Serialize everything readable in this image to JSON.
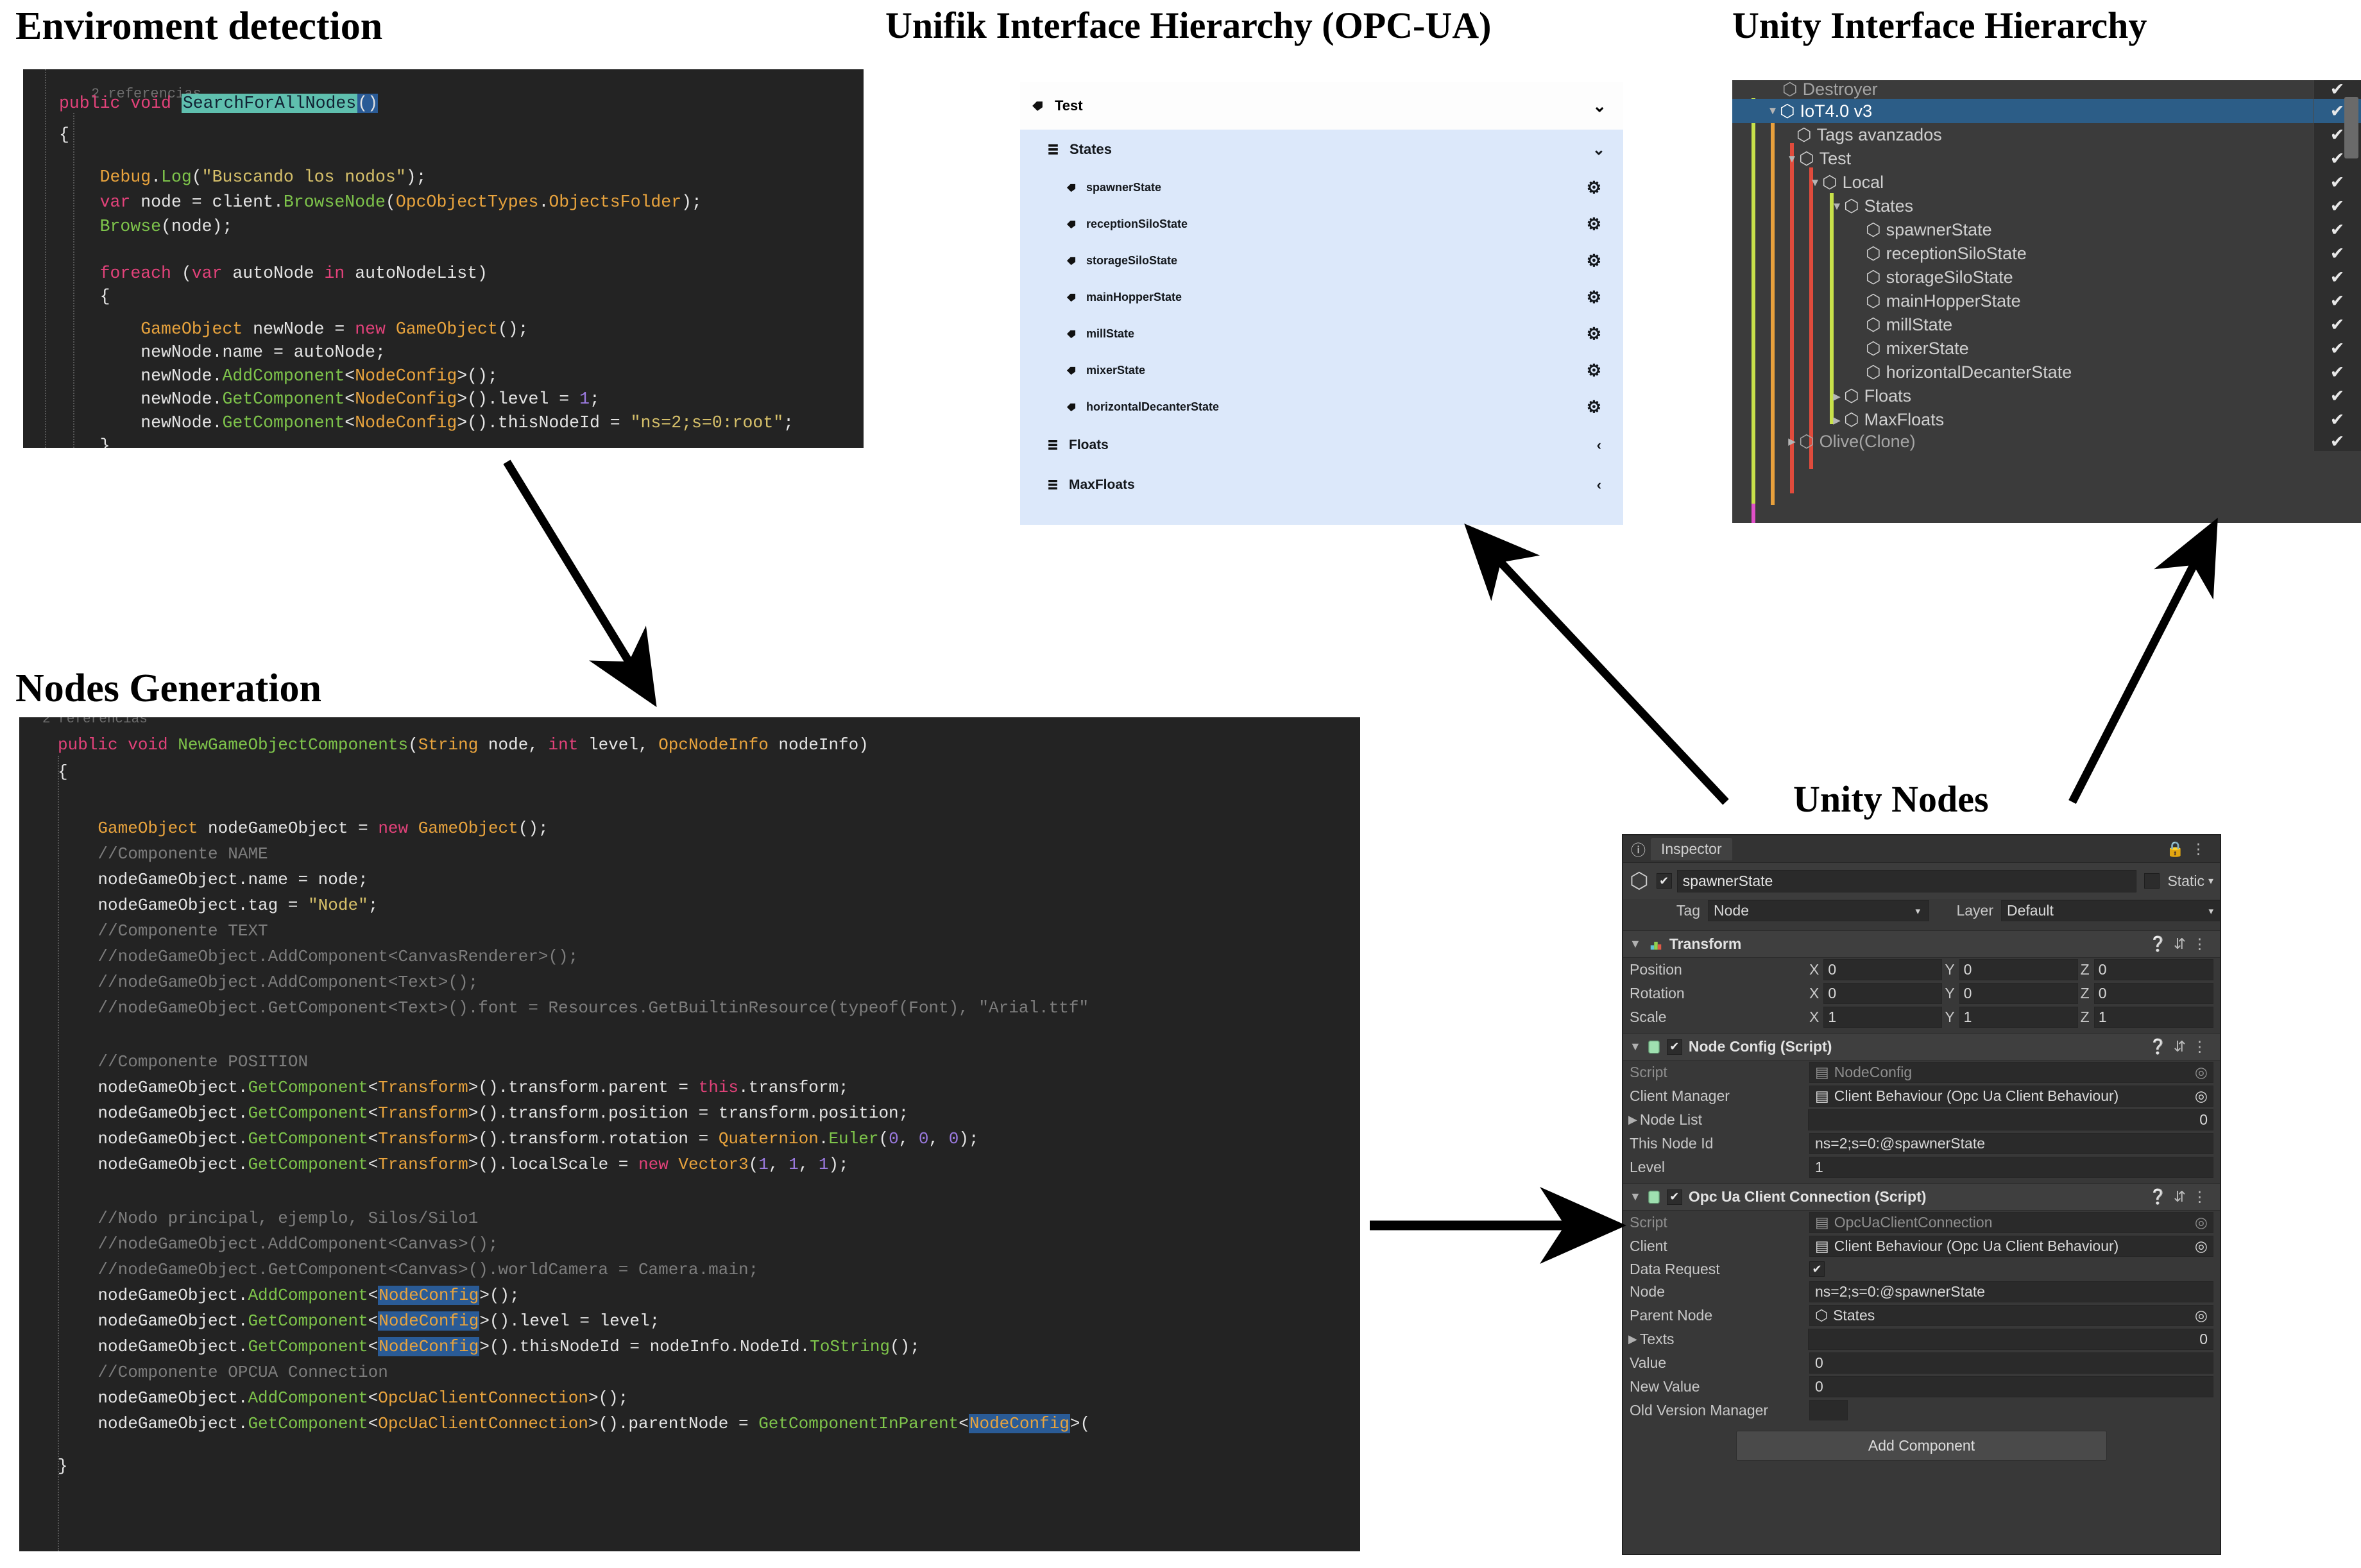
{
  "titles": {
    "environment_detection": "Enviroment detection",
    "unifik_hierarchy": "Unifik Interface Hierarchy (OPC-UA)",
    "unity_hierarchy": "Unity Interface Hierarchy",
    "nodes_generation": "Nodes Generation",
    "unity_nodes": "Unity Nodes"
  },
  "code_environment": {
    "reference_hint": "2 referencias",
    "lines": [
      "public void SearchForAllNodes()",
      "{",
      "    Debug.Log(\"Buscando los nodos\");",
      "    var node = client.BrowseNode(OpcObjectTypes.ObjectsFolder);",
      "    Browse(node);",
      "",
      "    foreach (var autoNode in autoNodeList)",
      "    {",
      "        GameObject newNode = new GameObject();",
      "        newNode.name = autoNode;",
      "        newNode.AddComponent<NodeConfig>();",
      "        newNode.GetComponent<NodeConfig>().level = 1;",
      "        newNode.GetComponent<NodeConfig>().thisNodeId = \"ns=2;s=0:root\";",
      "    }"
    ],
    "highlighted_symbol": "SearchForAllNodes"
  },
  "code_nodes_generation": {
    "lines": [
      "public void NewGameObjectComponents(String node, int level, OpcNodeInfo nodeInfo)",
      "{",
      "",
      "    GameObject nodeGameObject = new GameObject();",
      "    //Componente NAME",
      "    nodeGameObject.name = node;",
      "    nodeGameObject.tag = \"Node\";",
      "    //Componente TEXT",
      "    //nodeGameObject.AddComponent<CanvasRenderer>();",
      "    //nodeGameObject.AddComponent<Text>();",
      "    //nodeGameObject.GetComponent<Text>().font = Resources.GetBuiltinResource(typeof(Font), \"Arial.ttf\"",
      "",
      "    //Componente POSITION",
      "    nodeGameObject.GetComponent<Transform>().transform.parent = this.transform;",
      "    nodeGameObject.GetComponent<Transform>().transform.position = transform.position;",
      "    nodeGameObject.GetComponent<Transform>().transform.rotation = Quaternion.Euler(0, 0, 0);",
      "    nodeGameObject.GetComponent<Transform>().localScale = new Vector3(1, 1, 1);",
      "",
      "    //Nodo principal, ejemplo, Silos/Silo1",
      "    //nodeGameObject.AddComponent<Canvas>();",
      "    //nodeGameObject.GetComponent<Canvas>().worldCamera = Camera.main;",
      "    nodeGameObject.AddComponent<NodeConfig>();",
      "    nodeGameObject.GetComponent<NodeConfig>().level = level;",
      "    nodeGameObject.GetComponent<NodeConfig>().thisNodeId = nodeInfo.NodeId.ToString();",
      "    //Componente OPCUA Connection",
      "    nodeGameObject.AddComponent<OpcUaClientConnection>();",
      "    nodeGameObject.GetComponent<OpcUaClientConnection>().parentNode = GetComponentInParent<NodeConfig>(",
      "}"
    ],
    "highlighted_symbol": "NodeConfig"
  },
  "unifik": {
    "root": {
      "label": "Test",
      "icon": "tag-icon",
      "chevron": "chevron-down-icon"
    },
    "groups": [
      {
        "label": "States",
        "icon": "list-icon",
        "chevron": "chevron-down-icon",
        "items": [
          {
            "label": "spawnerState",
            "icon": "tag-icon",
            "action": "gear-icon"
          },
          {
            "label": "receptionSiloState",
            "icon": "tag-icon",
            "action": "gear-icon"
          },
          {
            "label": "storageSiloState",
            "icon": "tag-icon",
            "action": "gear-icon"
          },
          {
            "label": "mainHopperState",
            "icon": "tag-icon",
            "action": "gear-icon"
          },
          {
            "label": "millState",
            "icon": "tag-icon",
            "action": "gear-icon"
          },
          {
            "label": "mixerState",
            "icon": "tag-icon",
            "action": "gear-icon"
          },
          {
            "label": "horizontalDecanterState",
            "icon": "tag-icon",
            "action": "gear-icon"
          }
        ]
      },
      {
        "label": "Floats",
        "icon": "list-icon",
        "chevron": "chevron-left-icon",
        "items": []
      },
      {
        "label": "MaxFloats",
        "icon": "list-icon",
        "chevron": "chevron-left-icon",
        "items": []
      }
    ],
    "colors": {
      "panel_bg": "#dce8fa",
      "header_bg": "#fdfdfd"
    }
  },
  "unity_hierarchy": {
    "rows": [
      {
        "label": "Destroyer",
        "depth": 1,
        "fold": "",
        "checked": true,
        "selected": false,
        "clipped": true
      },
      {
        "label": "IoT4.0 v3",
        "depth": 1,
        "fold": "▼",
        "checked": true,
        "selected": true,
        "clipped": false
      },
      {
        "label": "Tags avanzados",
        "depth": 2,
        "fold": "",
        "checked": true,
        "selected": false,
        "clipped": false
      },
      {
        "label": "Test",
        "depth": 2,
        "fold": "▼",
        "checked": true,
        "selected": false,
        "clipped": false
      },
      {
        "label": "Local",
        "depth": 3,
        "fold": "▼",
        "checked": true,
        "selected": false,
        "clipped": false
      },
      {
        "label": "States",
        "depth": 4,
        "fold": "▼",
        "checked": true,
        "selected": false,
        "clipped": false
      },
      {
        "label": "spawnerState",
        "depth": 5,
        "fold": "",
        "checked": true,
        "selected": false,
        "clipped": false
      },
      {
        "label": "receptionSiloState",
        "depth": 5,
        "fold": "",
        "checked": true,
        "selected": false,
        "clipped": false
      },
      {
        "label": "storageSiloState",
        "depth": 5,
        "fold": "",
        "checked": true,
        "selected": false,
        "clipped": false
      },
      {
        "label": "mainHopperState",
        "depth": 5,
        "fold": "",
        "checked": true,
        "selected": false,
        "clipped": false
      },
      {
        "label": "millState",
        "depth": 5,
        "fold": "",
        "checked": true,
        "selected": false,
        "clipped": false
      },
      {
        "label": "mixerState",
        "depth": 5,
        "fold": "",
        "checked": true,
        "selected": false,
        "clipped": false
      },
      {
        "label": "horizontalDecanterState",
        "depth": 5,
        "fold": "",
        "checked": true,
        "selected": false,
        "clipped": false
      },
      {
        "label": "Floats",
        "depth": 4,
        "fold": "▶",
        "checked": true,
        "selected": false,
        "clipped": false
      },
      {
        "label": "MaxFloats",
        "depth": 4,
        "fold": "▶",
        "checked": true,
        "selected": false,
        "clipped": false
      },
      {
        "label": "Olive(Clone)",
        "depth": 2,
        "fold": "▶",
        "checked": true,
        "selected": false,
        "clipped": true
      }
    ],
    "colors": {
      "bg": "#3b3b3b",
      "selected": "#2c5d87"
    }
  },
  "inspector": {
    "tab_label": "Inspector",
    "lock_icon": "lock-icon",
    "menu_icon": "kebab-menu-icon",
    "object": {
      "enabled": true,
      "name": "spawnerState",
      "static_label": "Static",
      "tag_label": "Tag",
      "tag_value": "Node",
      "layer_label": "Layer",
      "layer_value": "Default"
    },
    "transform": {
      "title": "Transform",
      "rows": [
        {
          "label": "Position",
          "x": "0",
          "y": "0",
          "z": "0"
        },
        {
          "label": "Rotation",
          "x": "0",
          "y": "0",
          "z": "0"
        },
        {
          "label": "Scale",
          "x": "1",
          "y": "1",
          "z": "1"
        }
      ]
    },
    "node_config": {
      "title": "Node Config (Script)",
      "enabled": true,
      "fields": [
        {
          "label": "Script",
          "value": "NodeConfig",
          "dim": true,
          "type": "object"
        },
        {
          "label": "Client Manager",
          "value": "Client Behaviour (Opc Ua Client Behaviour)",
          "dim": false,
          "type": "object"
        },
        {
          "label": "Node List",
          "value": "0",
          "dim": false,
          "type": "count"
        },
        {
          "label": "This Node Id",
          "value": "ns=2;s=0:@spawnerState",
          "dim": false,
          "type": "text"
        },
        {
          "label": "Level",
          "value": "1",
          "dim": false,
          "type": "text"
        }
      ]
    },
    "opcua_connection": {
      "title": "Opc Ua Client Connection (Script)",
      "enabled": true,
      "fields": [
        {
          "label": "Script",
          "value": "OpcUaClientConnection",
          "dim": true,
          "type": "object"
        },
        {
          "label": "Client",
          "value": "Client Behaviour (Opc Ua Client Behaviour)",
          "dim": false,
          "type": "object"
        },
        {
          "label": "Data Request",
          "value": "✔",
          "dim": false,
          "type": "check"
        },
        {
          "label": "Node",
          "value": "ns=2;s=0:@spawnerState",
          "dim": false,
          "type": "text"
        },
        {
          "label": "Parent Node",
          "value": "States",
          "dim": false,
          "type": "object"
        },
        {
          "label": "Texts",
          "value": "0",
          "dim": false,
          "type": "count"
        },
        {
          "label": "Value",
          "value": "0",
          "dim": false,
          "type": "text"
        },
        {
          "label": "New Value",
          "value": "0",
          "dim": false,
          "type": "text"
        },
        {
          "label": "Old Version Manager",
          "value": "",
          "dim": false,
          "type": "small"
        }
      ]
    },
    "add_component_label": "Add Component"
  }
}
